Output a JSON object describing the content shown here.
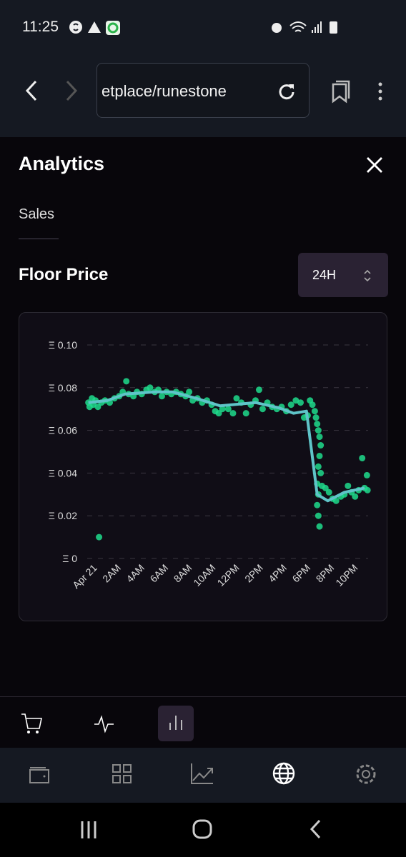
{
  "status_bar": {
    "time": "11:25",
    "left_icons": [
      "shazam-icon",
      "warning-icon",
      "app-notification-icon"
    ],
    "right_icons": [
      "alarm-icon",
      "wifi-icon",
      "signal-icon",
      "battery-icon"
    ]
  },
  "browser": {
    "url": "etplace/runestone",
    "icons": [
      "back-icon",
      "forward-icon",
      "reload-icon",
      "bookmarks-icon",
      "more-icon"
    ]
  },
  "panel": {
    "title": "Analytics",
    "close_icon": "close-icon",
    "tabs": [
      {
        "label": "Sales",
        "active": true
      }
    ]
  },
  "section": {
    "title": "Floor Price",
    "range_select": {
      "value": "24H"
    }
  },
  "chart_data": {
    "type": "scatter",
    "x_unit": "hour of Apr 21",
    "xlim": [
      -0.7,
      23
    ],
    "ylim": [
      0,
      0.1
    ],
    "grid": "horizontal dashed",
    "y_ticks": [
      0,
      0.02,
      0.04,
      0.06,
      0.08,
      0.1
    ],
    "y_tick_labels": [
      "Ξ 0",
      "Ξ 0.02",
      "Ξ 0.04",
      "Ξ 0.06",
      "Ξ 0.08",
      "Ξ 0.10"
    ],
    "x_ticks": [
      0,
      2,
      4,
      6,
      8,
      10,
      12,
      14,
      16,
      18,
      20,
      22
    ],
    "x_tick_labels": [
      "Apr 21",
      "2AM",
      "4AM",
      "6AM",
      "8AM",
      "10AM",
      "12PM",
      "2PM",
      "4PM",
      "6PM",
      "8PM",
      "10PM"
    ],
    "colors": {
      "points": "#1fdc8c",
      "line": "#5fc4c8",
      "grid": "#3a3640"
    },
    "points": [
      [
        -0.6,
        0.073
      ],
      [
        -0.5,
        0.071
      ],
      [
        -0.3,
        0.075
      ],
      [
        -0.2,
        0.072
      ],
      [
        0,
        0.074
      ],
      [
        0.2,
        0.071
      ],
      [
        0.3,
        0.01
      ],
      [
        0.5,
        0.073
      ],
      [
        0.8,
        0.074
      ],
      [
        1.2,
        0.073
      ],
      [
        1.6,
        0.075
      ],
      [
        2,
        0.076
      ],
      [
        2.3,
        0.078
      ],
      [
        2.6,
        0.083
      ],
      [
        2.8,
        0.077
      ],
      [
        3.2,
        0.076
      ],
      [
        3.5,
        0.078
      ],
      [
        3.9,
        0.077
      ],
      [
        4.3,
        0.079
      ],
      [
        4.6,
        0.08
      ],
      [
        5,
        0.078
      ],
      [
        5.3,
        0.079
      ],
      [
        5.6,
        0.076
      ],
      [
        6,
        0.078
      ],
      [
        6.4,
        0.077
      ],
      [
        6.8,
        0.078
      ],
      [
        7.2,
        0.077
      ],
      [
        7.6,
        0.076
      ],
      [
        7.9,
        0.078
      ],
      [
        8.2,
        0.074
      ],
      [
        8.6,
        0.075
      ],
      [
        9,
        0.073
      ],
      [
        9.4,
        0.074
      ],
      [
        9.8,
        0.072
      ],
      [
        10.1,
        0.069
      ],
      [
        10.4,
        0.068
      ],
      [
        10.7,
        0.07
      ],
      [
        11.2,
        0.07
      ],
      [
        11.6,
        0.068
      ],
      [
        11.9,
        0.075
      ],
      [
        12.3,
        0.073
      ],
      [
        12.7,
        0.068
      ],
      [
        13.1,
        0.072
      ],
      [
        13.5,
        0.074
      ],
      [
        13.8,
        0.079
      ],
      [
        14.1,
        0.07
      ],
      [
        14.5,
        0.073
      ],
      [
        14.9,
        0.071
      ],
      [
        15.3,
        0.07
      ],
      [
        15.7,
        0.071
      ],
      [
        16.1,
        0.069
      ],
      [
        16.5,
        0.072
      ],
      [
        16.9,
        0.074
      ],
      [
        17.3,
        0.073
      ],
      [
        17.6,
        0.066
      ],
      [
        17.9,
        0.067
      ],
      [
        18.1,
        0.074
      ],
      [
        18.3,
        0.072
      ],
      [
        18.5,
        0.069
      ],
      [
        18.6,
        0.066
      ],
      [
        18.7,
        0.063
      ],
      [
        18.8,
        0.06
      ],
      [
        18.9,
        0.057
      ],
      [
        19,
        0.053
      ],
      [
        18.9,
        0.048
      ],
      [
        18.8,
        0.043
      ],
      [
        19,
        0.04
      ],
      [
        18.7,
        0.035
      ],
      [
        18.8,
        0.03
      ],
      [
        18.7,
        0.025
      ],
      [
        18.8,
        0.02
      ],
      [
        18.9,
        0.015
      ],
      [
        19.1,
        0.034
      ],
      [
        19.4,
        0.033
      ],
      [
        19.7,
        0.031
      ],
      [
        20,
        0.028
      ],
      [
        20.3,
        0.027
      ],
      [
        20.7,
        0.029
      ],
      [
        21,
        0.03
      ],
      [
        21.3,
        0.034
      ],
      [
        21.6,
        0.031
      ],
      [
        21.9,
        0.029
      ],
      [
        22.2,
        0.032
      ],
      [
        22.5,
        0.047
      ],
      [
        22.7,
        0.033
      ],
      [
        22.9,
        0.039
      ],
      [
        22.95,
        0.032
      ]
    ],
    "trend_line": [
      [
        -0.6,
        0.073
      ],
      [
        1,
        0.074
      ],
      [
        2.5,
        0.077
      ],
      [
        5,
        0.078
      ],
      [
        6.5,
        0.078
      ],
      [
        8.5,
        0.075
      ],
      [
        10.5,
        0.0715
      ],
      [
        13.5,
        0.073
      ],
      [
        15.5,
        0.0705
      ],
      [
        16.7,
        0.068
      ],
      [
        17.8,
        0.069
      ],
      [
        18.7,
        0.03
      ],
      [
        19.6,
        0.027
      ],
      [
        21,
        0.031
      ],
      [
        22.7,
        0.033
      ]
    ]
  },
  "action_tabs": [
    {
      "icon": "cart-icon"
    },
    {
      "icon": "activity-icon"
    },
    {
      "icon": "bar-chart-icon",
      "active": true
    }
  ],
  "bottom_nav": [
    {
      "icon": "wallet-icon"
    },
    {
      "icon": "grid-icon"
    },
    {
      "icon": "trending-icon"
    },
    {
      "icon": "globe-icon",
      "active": true
    },
    {
      "icon": "settings-icon"
    }
  ],
  "system_nav": [
    "recents-icon",
    "home-icon",
    "back-icon"
  ]
}
